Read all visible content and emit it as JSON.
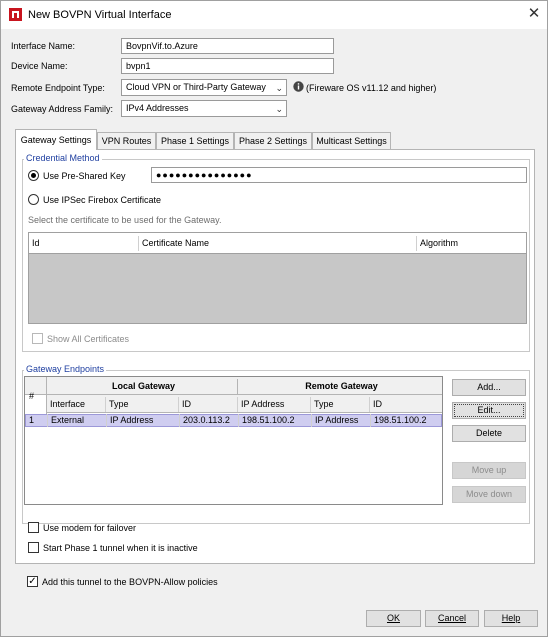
{
  "window": {
    "title": "New BOVPN Virtual Interface",
    "close_glyph": "✕"
  },
  "form": {
    "interface_name_label": "Interface Name:",
    "interface_name_value": "BovpnVif.to.Azure",
    "device_name_label": "Device Name:",
    "device_name_value": "bvpn1",
    "remote_endpoint_label": "Remote Endpoint Type:",
    "remote_endpoint_value": "Cloud VPN or Third-Party Gateway",
    "remote_endpoint_note": "(Fireware OS v11.12 and higher)",
    "gateway_family_label": "Gateway Address Family:",
    "gateway_family_value": "IPv4 Addresses"
  },
  "tabs": [
    {
      "label": "Gateway Settings",
      "active": true
    },
    {
      "label": "VPN Routes"
    },
    {
      "label": "Phase 1 Settings"
    },
    {
      "label": "Phase 2 Settings"
    },
    {
      "label": "Multicast Settings"
    }
  ],
  "credential": {
    "group_title": "Credential Method",
    "psk_label": "Use Pre-Shared Key",
    "psk_value": "●●●●●●●●●●●●●●●",
    "cert_label": "Use IPSec Firebox Certificate",
    "cert_hint": "Select the certificate to be used for the Gateway.",
    "cert_columns": [
      "Id",
      "Certificate Name",
      "Algorithm"
    ],
    "show_all_label": "Show All Certificates"
  },
  "endpoints": {
    "group_title": "Gateway Endpoints",
    "num_header": "#",
    "local_header": "Local Gateway",
    "remote_header": "Remote Gateway",
    "sub_headers": [
      "Interface",
      "Type",
      "ID",
      "IP Address",
      "Type",
      "ID"
    ],
    "rows": [
      {
        "num": "1",
        "cells": [
          "External",
          "IP Address",
          "203.0.113.2",
          "198.51.100.2",
          "IP Address",
          "198.51.100.2"
        ]
      }
    ],
    "add_label": "Add...",
    "edit_label": "Edit...",
    "delete_label": "Delete",
    "move_up_label": "Move up",
    "move_down_label": "Move down"
  },
  "options": {
    "modem_label": "Use modem for failover",
    "phase1_label": "Start Phase 1 tunnel when it is inactive",
    "policy_label": "Add this tunnel to the BOVPN-Allow policies",
    "policy_checked": "✓"
  },
  "footer": {
    "ok_label": "OK",
    "cancel_label": "Cancel",
    "help_label": "Help"
  },
  "icons": {
    "info_glyph": "i"
  },
  "colors": {
    "selected_row": "#cfcdf0",
    "group_title": "#1f3fa0",
    "app_icon_red": "#c8141e"
  }
}
